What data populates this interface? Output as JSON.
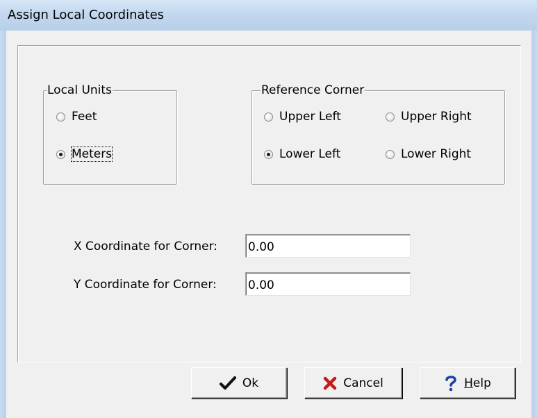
{
  "window": {
    "title": "Assign Local Coordinates"
  },
  "local_units": {
    "legend": "Local Units",
    "options": [
      {
        "label": "Feet",
        "checked": false
      },
      {
        "label": "Meters",
        "checked": true
      }
    ]
  },
  "reference_corner": {
    "legend": "Reference Corner",
    "options": [
      {
        "label": "Upper Left",
        "checked": false
      },
      {
        "label": "Upper Right",
        "checked": false
      },
      {
        "label": "Lower Left",
        "checked": true
      },
      {
        "label": "Lower Right",
        "checked": false
      }
    ]
  },
  "coordinates": {
    "x_label": "X Coordinate for Corner:",
    "x_value": "0.00",
    "y_label": "Y Coordinate for Corner:",
    "y_value": "0.00"
  },
  "buttons": {
    "ok_label": "Ok",
    "cancel_label": "Cancel",
    "help_label_prefix": "",
    "help_label_mnemonic": "H",
    "help_label_rest": "elp"
  },
  "icons": {
    "ok": "checkmark-icon",
    "cancel": "red-x-icon",
    "help": "question-mark-icon"
  },
  "colors": {
    "title_bar": "#c3d8ef",
    "cancel_icon": "#c8181e",
    "help_icon": "#1f3fa8"
  }
}
